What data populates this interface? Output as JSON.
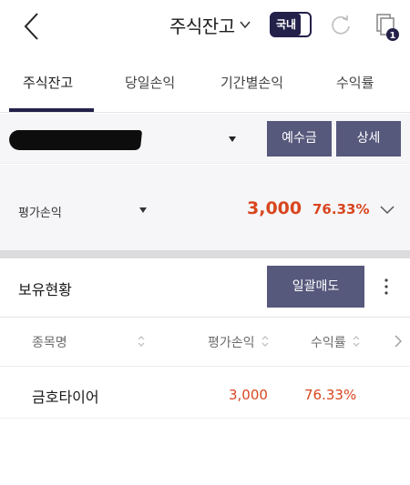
{
  "header": {
    "back_icon": "chevron-left-icon",
    "title": "주식잔고",
    "title_caret_icon": "chevron-down-icon",
    "market_toggle": "국내",
    "refresh_icon": "refresh-icon",
    "copy_icon": "copy-icon",
    "copy_badge": "1"
  },
  "tabs": [
    {
      "label": "주식잔고",
      "active": true
    },
    {
      "label": "당일손익",
      "active": false
    },
    {
      "label": "기간별손익",
      "active": false
    },
    {
      "label": "수익률",
      "active": false
    }
  ],
  "account": {
    "masked": true,
    "dropdown_icon": "caret-down-icon",
    "deposit_label": "예수금",
    "detail_label": "상세"
  },
  "evaluation": {
    "label": "평가손익",
    "amount": "3,000",
    "rate": "76.33%",
    "expand_icon": "chevron-down-icon"
  },
  "holdings": {
    "title": "보유현황",
    "bulk_sell_label": "일괄매도",
    "more_icon": "kebab-icon",
    "columns": [
      "종목명",
      "평가손익",
      "수익률"
    ],
    "next_icon": "chevron-right-icon",
    "rows": [
      {
        "name": "금호타이어",
        "eval": "3,000",
        "rate": "76.33%"
      }
    ]
  },
  "colors": {
    "navy": "#23204a",
    "button": "#56587c",
    "profit": "#d8461f",
    "panel_bg": "#f6f6f8"
  }
}
